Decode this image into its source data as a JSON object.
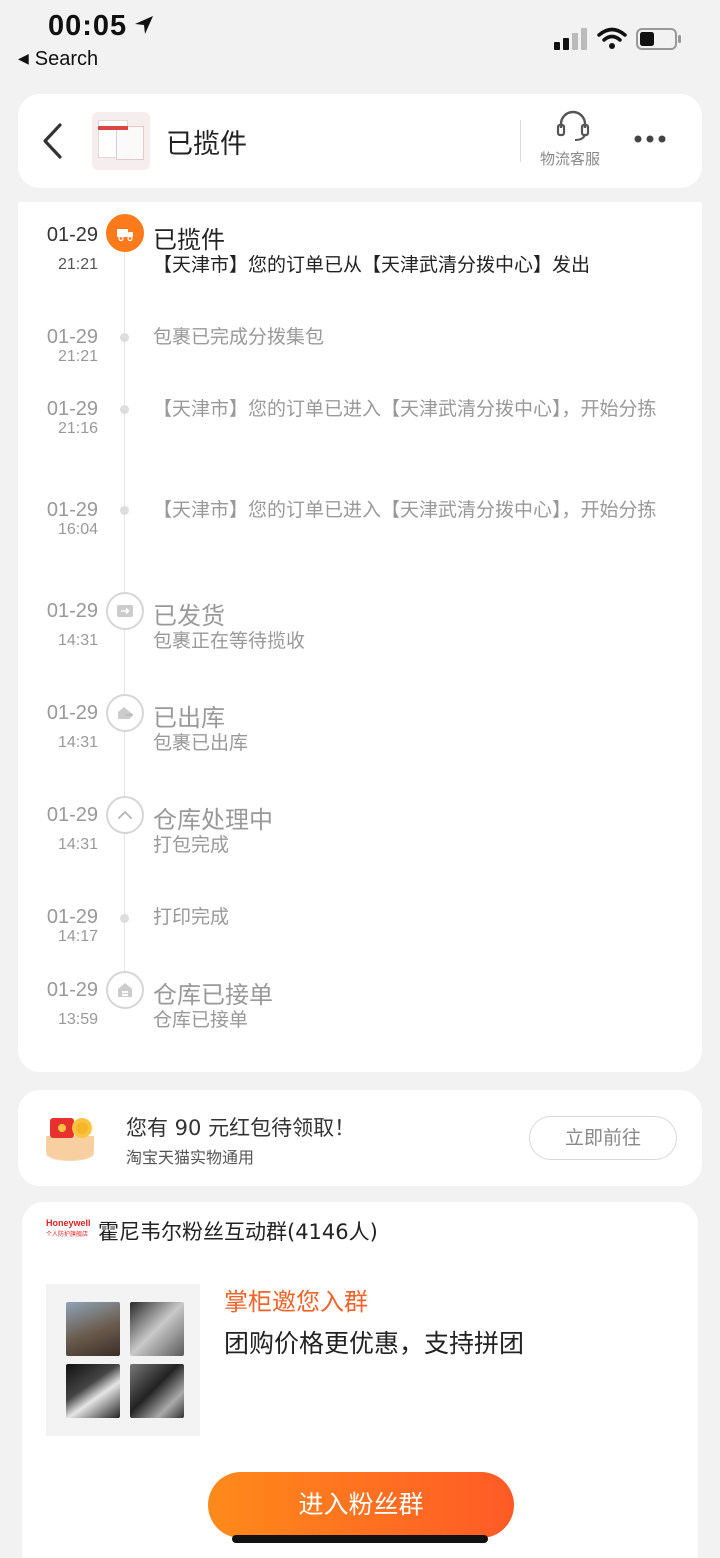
{
  "status_bar": {
    "time": "00:05",
    "back_label": "Search"
  },
  "header": {
    "title": "已揽件",
    "customer_service_label": "物流客服"
  },
  "timeline": [
    {
      "date": "01-29",
      "time": "21:21",
      "title": "已揽件",
      "text": "【天津市】您的订单已从【天津武清分拨中心】发出",
      "icon": "truck-icon",
      "active": true
    },
    {
      "date": "01-29",
      "time": "21:21",
      "title": "",
      "text": "包裹已完成分拨集包",
      "icon": "dot",
      "active": false
    },
    {
      "date": "01-29",
      "time": "21:16",
      "title": "",
      "text": "【天津市】您的订单已进入【天津武清分拨中心】，开始分拣",
      "icon": "dot",
      "active": false
    },
    {
      "date": "01-29",
      "time": "16:04",
      "title": "",
      "text": "【天津市】您的订单已进入【天津武清分拨中心】，开始分拣",
      "icon": "dot",
      "active": false
    },
    {
      "date": "01-29",
      "time": "14:31",
      "title": "已发货",
      "text": "包裹正在等待揽收",
      "icon": "shipped-icon",
      "active": false
    },
    {
      "date": "01-29",
      "time": "14:31",
      "title": "已出库",
      "text": "包裹已出库",
      "icon": "outbound-icon",
      "active": false
    },
    {
      "date": "01-29",
      "time": "14:31",
      "title": "仓库处理中",
      "text": "打包完成",
      "icon": "chevron-up-icon",
      "active": false
    },
    {
      "date": "01-29",
      "time": "14:17",
      "title": "",
      "text": "打印完成",
      "icon": "dot",
      "active": false
    },
    {
      "date": "01-29",
      "time": "13:59",
      "title": "仓库已接单",
      "text": "仓库已接单",
      "icon": "warehouse-icon",
      "active": false
    }
  ],
  "red_packet": {
    "title": "您有 90 元红包待领取！",
    "subtitle": "淘宝天猫实物通用",
    "button_label": "立即前往"
  },
  "group": {
    "brand_logo_text": "Honeywell",
    "brand_logo_sub": "个人防护旗舰店",
    "name": "霍尼韦尔粉丝互动群(4146人)",
    "invite_title": "掌柜邀您入群",
    "invite_desc": "团购价格更优惠，支持拼团",
    "join_button_label": "进入粉丝群"
  },
  "colors": {
    "accent": "#ff7a1a",
    "invite_text": "#f0632a",
    "join_gradient_start": "#ff8a1a",
    "join_gradient_end": "#ff5a26"
  }
}
